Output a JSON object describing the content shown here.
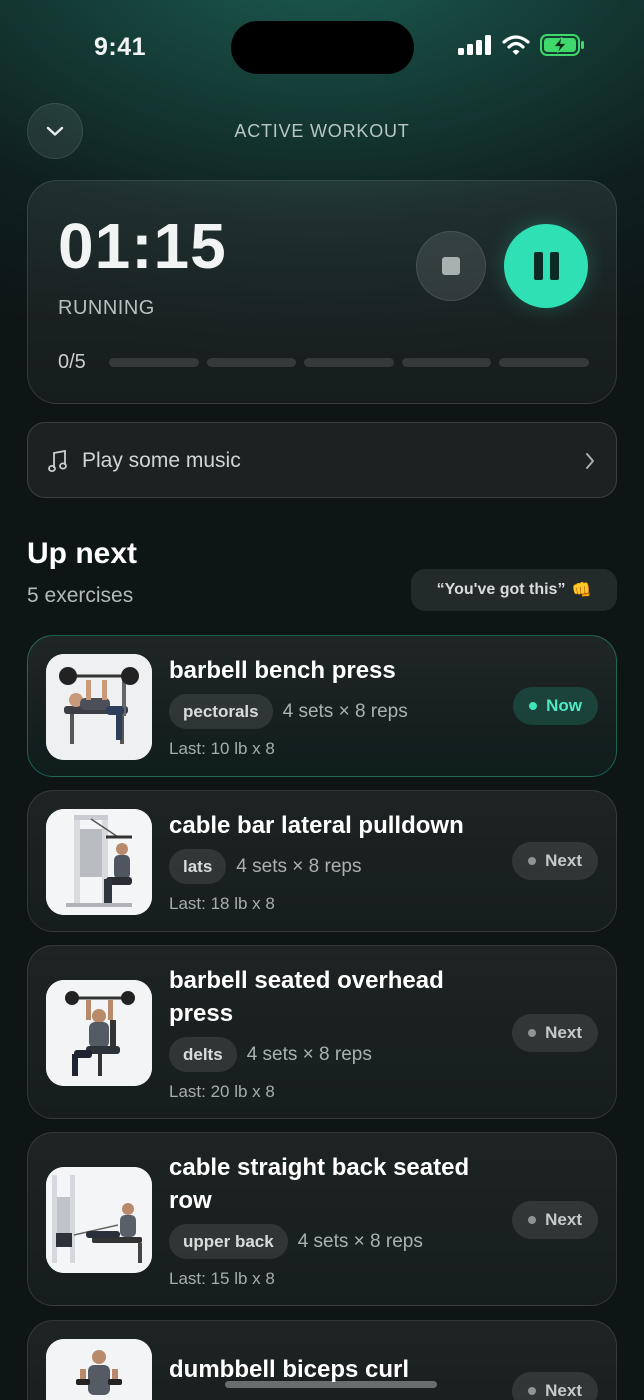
{
  "status_bar": {
    "time": "9:41"
  },
  "header": {
    "title": "ACTIVE WORKOUT"
  },
  "timer": {
    "value": "01:15",
    "state": "RUNNING",
    "progress_label": "0/5",
    "completed": 0,
    "total": 5
  },
  "music": {
    "label": "Play some music"
  },
  "up_next": {
    "title": "Up next",
    "count": "5 exercises",
    "motivation": "“You've got this”",
    "motivation_emoji": "👊"
  },
  "exercises": [
    {
      "name": "barbell bench press",
      "muscle": "pectorals",
      "sets": "4 sets × 8 reps",
      "last": "Last: 10 lb x 8",
      "status": "Now"
    },
    {
      "name": "cable bar lateral pulldown",
      "muscle": "lats",
      "sets": "4 sets × 8 reps",
      "last": "Last: 18 lb x 8",
      "status": "Next"
    },
    {
      "name": "barbell seated overhead press",
      "muscle": "delts",
      "sets": "4 sets × 8 reps",
      "last": "Last: 20 lb x 8",
      "status": "Next"
    },
    {
      "name": "cable straight back seated row",
      "muscle": "upper back",
      "sets": "4 sets × 8 reps",
      "last": "Last: 15 lb x 8",
      "status": "Next"
    },
    {
      "name": "dumbbell biceps curl",
      "muscle": "",
      "sets": "",
      "last": "",
      "status": "Next"
    }
  ],
  "colors": {
    "accent": "#2fe0b4",
    "background": "#0e1515"
  },
  "icons": [
    "signal-icon",
    "wifi-icon",
    "battery-charging-icon",
    "chevron-down-icon",
    "stop-icon",
    "pause-icon",
    "music-note-icon",
    "chevron-right-icon"
  ]
}
